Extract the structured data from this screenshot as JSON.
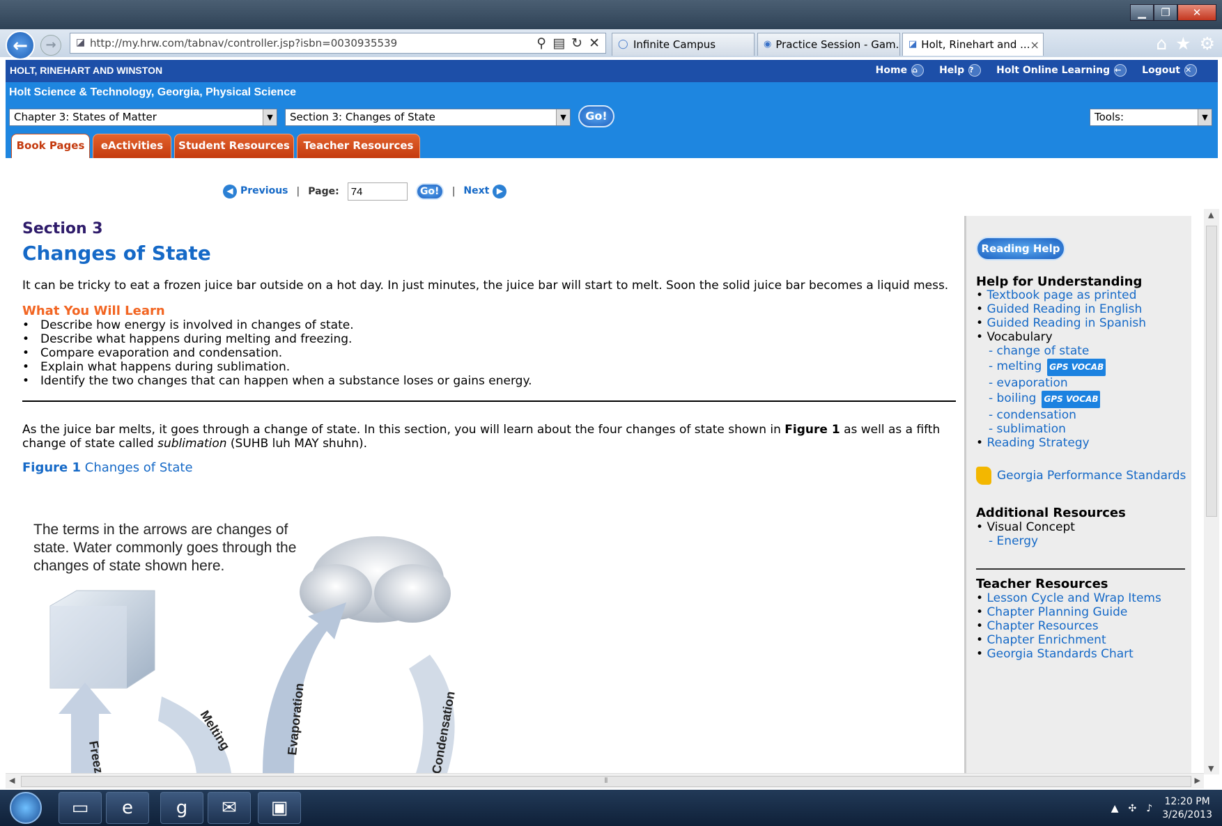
{
  "browser": {
    "address": "http://my.hrw.com/tabnav/controller.jsp?isbn=0030935539",
    "tabs": [
      {
        "label": "Infinite Campus"
      },
      {
        "label": "Practice Session - Gam..."
      },
      {
        "label": "Holt, Rinehart and ..."
      }
    ],
    "tab_close": "×"
  },
  "site": {
    "brand": "HOLT, RINEHART AND WINSTON",
    "top_links": [
      "Home",
      "Help",
      "Holt Online Learning",
      "Logout"
    ],
    "book_title": "Holt Science & Technology, Georgia, Physical Science",
    "chapter_select": "Chapter 3: States of Matter",
    "section_select": "Section 3: Changes of State",
    "go": "Go!",
    "tools_select": "Tools:",
    "nav_tabs": [
      "Book Pages",
      "eActivities",
      "Student Resources",
      "Teacher Resources"
    ]
  },
  "pager": {
    "previous": "Previous",
    "page_label": "Page:",
    "page_value": "74",
    "go": "Go!",
    "next": "Next",
    "sep": "|"
  },
  "content": {
    "section_label": "Section 3",
    "title": "Changes of State",
    "intro": "It can be tricky to eat a frozen juice bar outside on a hot day. In just minutes, the juice bar will start to melt. Soon the solid juice bar becomes a liquid mess.",
    "learn_heading": "What You Will Learn",
    "objectives": [
      "Describe how energy is involved in changes of state.",
      "Describe what happens during melting and freezing.",
      "Compare evaporation and condensation.",
      "Explain what happens during sublimation.",
      "Identify the two changes that can happen when a substance loses or gains energy."
    ],
    "para2_a": "As the juice bar melts, it goes through a change of state. In this section, you will learn about the four changes of state shown in ",
    "para2_bold": "Figure 1",
    "para2_b": " as well as a fifth change of state called ",
    "para2_italic": "sublimation",
    "para2_c": " (SUHB luh MAY shuhn).",
    "figure_label": "Figure 1",
    "figure_caption": "Changes of State",
    "figure_note": "The terms in the arrows are changes of state. Water commonly goes through the changes of state shown here.",
    "arrow_labels": [
      "Freezing",
      "Melting",
      "Evaporation",
      "Condensation"
    ]
  },
  "sidebar": {
    "reading_help": "Reading Help",
    "help_heading": "Help for Understanding",
    "help_items": [
      "Textbook page as printed",
      "Guided Reading in English",
      "Guided Reading in Spanish"
    ],
    "vocab_label": "Vocabulary",
    "vocab_items": [
      "change of state",
      "melting",
      "evaporation",
      "boiling",
      "condensation",
      "sublimation"
    ],
    "gps_badge": "GPS VOCAB",
    "reading_strategy": "Reading Strategy",
    "georgia_standards": "Georgia Performance Standards",
    "additional_heading": "Additional Resources",
    "visual_concept": "Visual Concept",
    "energy": "Energy",
    "teacher_heading": "Teacher Resources",
    "teacher_items": [
      "Lesson Cycle and Wrap Items",
      "Chapter Planning Guide",
      "Chapter Resources",
      "Chapter Enrichment",
      "Georgia Standards Chart"
    ]
  },
  "taskbar": {
    "time": "12:20 PM",
    "date": "3/26/2013"
  },
  "colors": {
    "header_blue": "#1e86e0",
    "tab_orange": "#c43a0e",
    "link_blue": "#1569c7",
    "section_purple": "#2e1b6a",
    "learn_orange": "#f26522"
  }
}
